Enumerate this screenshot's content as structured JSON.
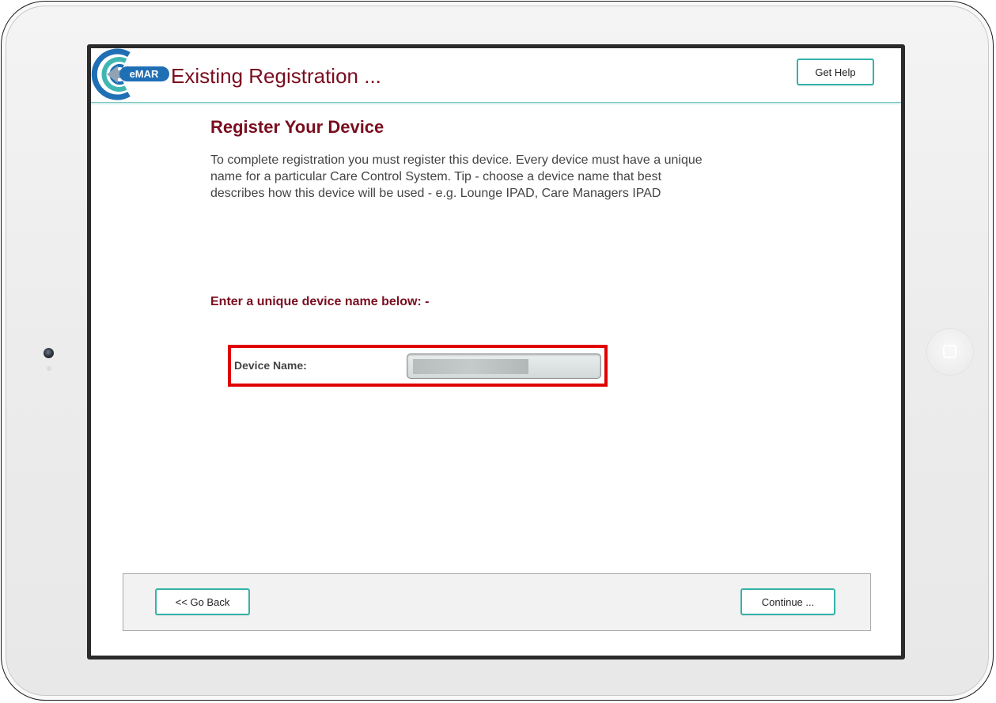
{
  "header": {
    "title": "Existing Registration ...",
    "help_label": "Get Help",
    "logo_badge": "eMAR"
  },
  "main": {
    "title": "Register Your Device",
    "description_lines": [
      "To complete registration you must register this device.  Every device must have a unique",
      "name for a particular Care Control System.  Tip - choose a device name that best",
      "describes how this device will be used - e.g. Lounge IPAD, Care Managers IPAD"
    ],
    "prompt": "Enter a unique device name below: -",
    "device_field": {
      "label": "Device Name:",
      "value": "",
      "placeholder": ""
    }
  },
  "footer": {
    "back_label": "<< Go Back",
    "continue_label": "Continue ..."
  },
  "colors": {
    "brand_maroon": "#7a0d1f",
    "accent_teal": "#34b3a9",
    "highlight_red": "#e00000",
    "logo_blue": "#1f6fb5"
  }
}
